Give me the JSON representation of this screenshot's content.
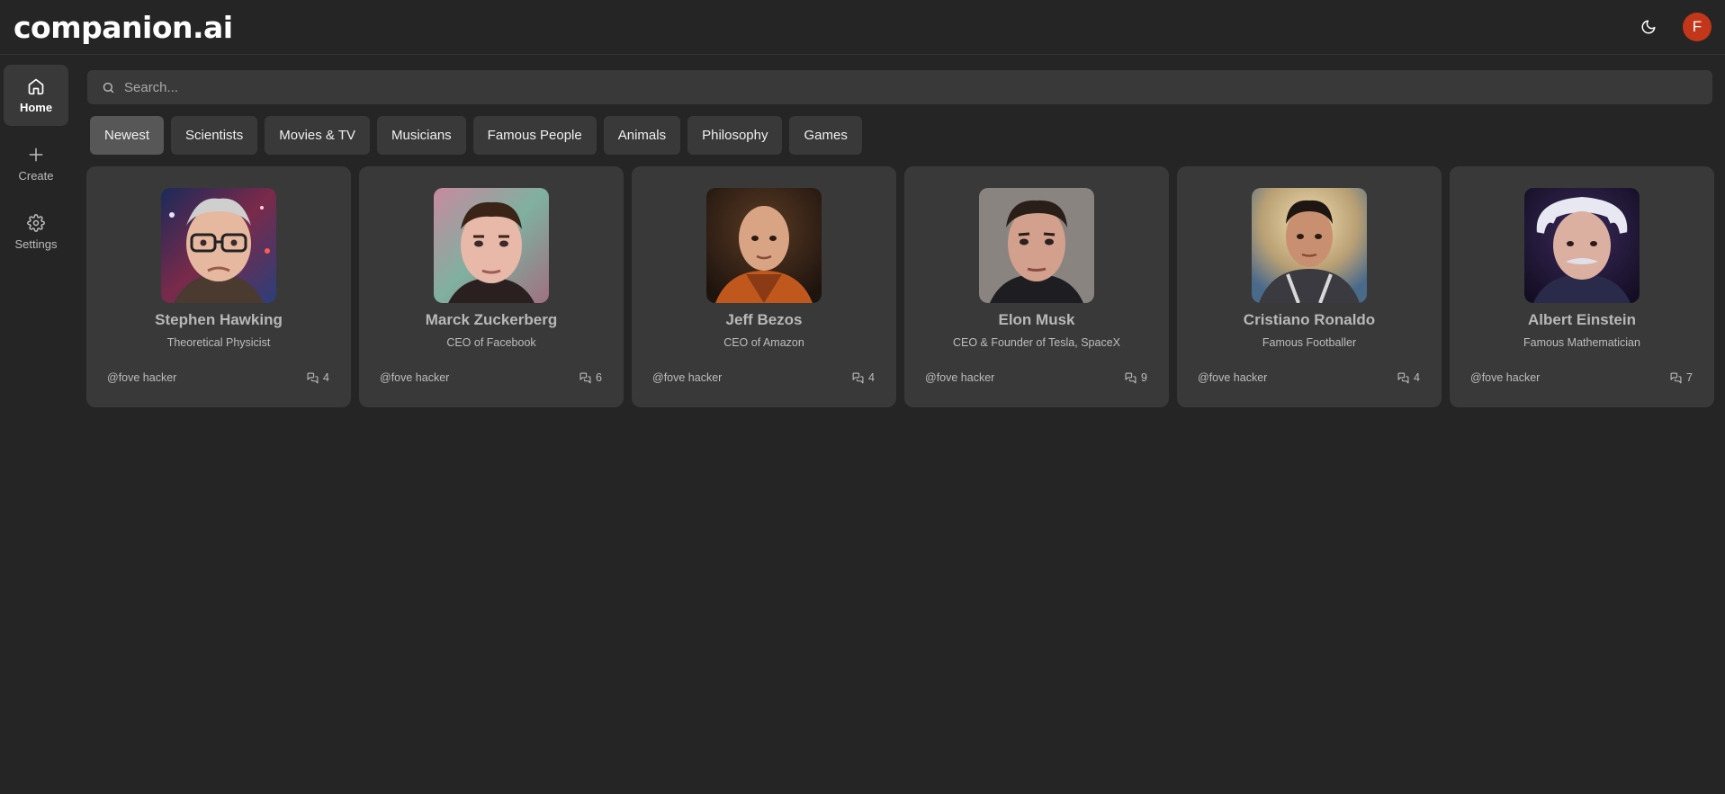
{
  "app": {
    "logo": "companion.ai",
    "user_initial": "F"
  },
  "sidebar": {
    "items": [
      {
        "label": "Home",
        "icon": "home-icon",
        "active": true
      },
      {
        "label": "Create",
        "icon": "plus-icon",
        "active": false
      },
      {
        "label": "Settings",
        "icon": "gear-icon",
        "active": false
      }
    ]
  },
  "search": {
    "placeholder": "Search..."
  },
  "categories": [
    {
      "label": "Newest",
      "active": true
    },
    {
      "label": "Scientists"
    },
    {
      "label": "Movies & TV"
    },
    {
      "label": "Musicians"
    },
    {
      "label": "Famous People"
    },
    {
      "label": "Animals"
    },
    {
      "label": "Philosophy"
    },
    {
      "label": "Games"
    }
  ],
  "companions": [
    {
      "name": "Stephen Hawking",
      "description": "Theoretical Physicist",
      "author": "@fove hacker",
      "messages": "4"
    },
    {
      "name": "Marck Zuckerberg",
      "description": "CEO of Facebook",
      "author": "@fove hacker",
      "messages": "6"
    },
    {
      "name": "Jeff Bezos",
      "description": "CEO of Amazon",
      "author": "@fove hacker",
      "messages": "4"
    },
    {
      "name": "Elon Musk",
      "description": "CEO & Founder of Tesla, SpaceX",
      "author": "@fove hacker",
      "messages": "9"
    },
    {
      "name": "Cristiano Ronaldo",
      "description": "Famous Footballer",
      "author": "@fove hacker",
      "messages": "4"
    },
    {
      "name": "Albert Einstein",
      "description": "Famous Mathematician",
      "author": "@fove hacker",
      "messages": "7"
    }
  ],
  "colors": {
    "background": "#252525",
    "surface": "#393939",
    "active_tab": "#575757",
    "avatar": "#c2361a"
  }
}
